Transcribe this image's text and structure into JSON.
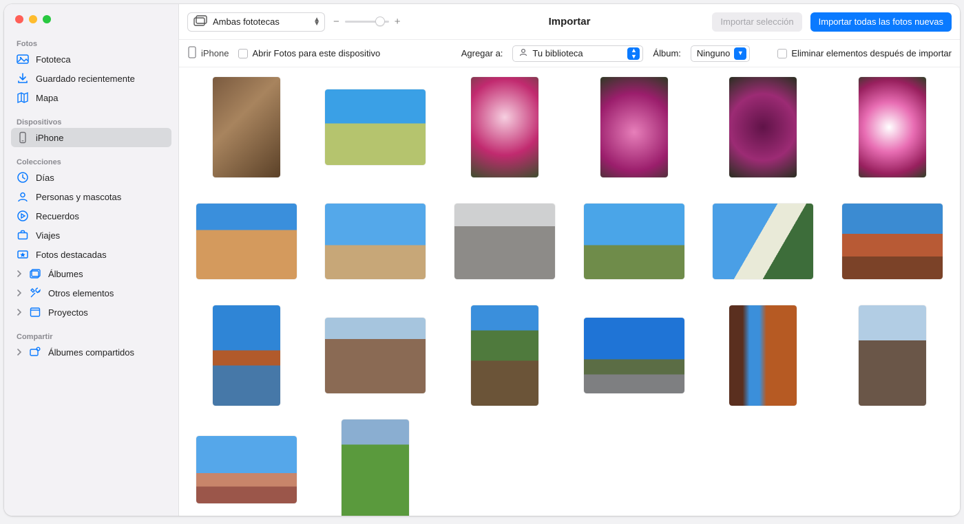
{
  "toolbar": {
    "library_selector": "Ambas fototecas",
    "zoom_minus": "−",
    "zoom_plus": "+",
    "title": "Importar",
    "import_selection": "Importar selección",
    "import_all_new": "Importar todas las fotos nuevas"
  },
  "optionsbar": {
    "device_name": "iPhone",
    "open_photos_checkbox": "Abrir Fotos para este dispositivo",
    "add_to_label": "Agregar a:",
    "add_to_value": "Tu biblioteca",
    "album_label": "Álbum:",
    "album_value": "Ninguno",
    "delete_after_import": "Eliminar elementos después de importar"
  },
  "sidebar": {
    "sections": {
      "photos": "Fotos",
      "devices": "Dispositivos",
      "collections": "Colecciones",
      "share": "Compartir"
    },
    "items": {
      "library": "Fototeca",
      "recently_saved": "Guardado recientemente",
      "map": "Mapa",
      "iphone": "iPhone",
      "days": "Días",
      "people_pets": "Personas y mascotas",
      "memories": "Recuerdos",
      "trips": "Viajes",
      "featured": "Fotos destacadas",
      "albums": "Álbumes",
      "other": "Otros elementos",
      "projects": "Proyectos",
      "shared_albums": "Álbumes compartidos"
    }
  },
  "photos": [
    {
      "name": "bark-portrait",
      "shape": "portrait",
      "fill": "p-bark"
    },
    {
      "name": "mesa-grass",
      "shape": "square",
      "fill": "p-mesa"
    },
    {
      "name": "pink-orchid",
      "shape": "portrait",
      "fill": "p-orchid"
    },
    {
      "name": "pink-tulip-open",
      "shape": "portrait",
      "fill": "p-tulip1"
    },
    {
      "name": "dark-tulip",
      "shape": "portrait",
      "fill": "p-tulip2"
    },
    {
      "name": "pink-tulip-closeup",
      "shape": "portrait",
      "fill": "p-tulip3"
    },
    {
      "name": "bryce-canyon",
      "shape": "square",
      "fill": "p-bryce"
    },
    {
      "name": "dunes",
      "shape": "square",
      "fill": "p-dunes"
    },
    {
      "name": "badlands-bw",
      "shape": "square",
      "fill": "p-badlands"
    },
    {
      "name": "plain-sky",
      "shape": "square",
      "fill": "p-plain"
    },
    {
      "name": "white-cliff",
      "shape": "square",
      "fill": "p-whitecliff"
    },
    {
      "name": "red-rock-layers",
      "shape": "square",
      "fill": "p-redrock"
    },
    {
      "name": "reflection-lake",
      "shape": "portrait",
      "fill": "p-reflection"
    },
    {
      "name": "grand-canyon",
      "shape": "square",
      "fill": "p-canyon"
    },
    {
      "name": "creek-trees",
      "shape": "portrait",
      "fill": "p-creek"
    },
    {
      "name": "desert-road",
      "shape": "square",
      "fill": "p-road"
    },
    {
      "name": "slot-canyon",
      "shape": "portrait",
      "fill": "p-slot"
    },
    {
      "name": "petrified-wood",
      "shape": "portrait",
      "fill": "p-petrified"
    },
    {
      "name": "painted-desert",
      "shape": "wide",
      "fill": "p-painted"
    },
    {
      "name": "green-meadow",
      "shape": "portrait",
      "fill": "p-meadow"
    }
  ]
}
